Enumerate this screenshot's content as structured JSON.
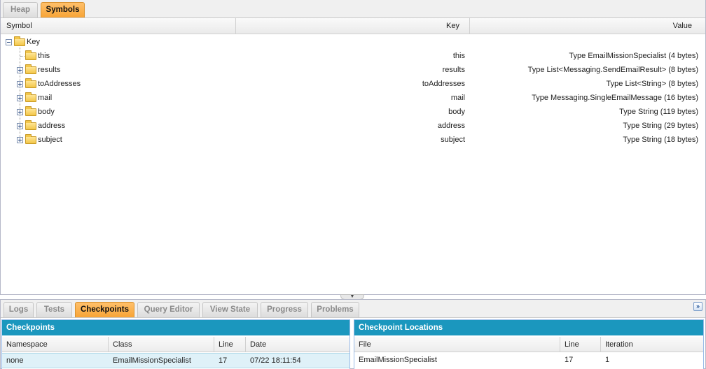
{
  "top_tabs": [
    {
      "label": "Heap",
      "active": false
    },
    {
      "label": "Symbols",
      "active": true
    }
  ],
  "symbols_table": {
    "columns": {
      "symbol": "Symbol",
      "key": "Key",
      "value": "Value"
    },
    "root": {
      "name": "Key",
      "expanded": true
    },
    "rows": [
      {
        "name": "this",
        "key": "this",
        "value": "Type EmailMissionSpecialist (4 bytes)",
        "expandable": false
      },
      {
        "name": "results",
        "key": "results",
        "value": "Type List<Messaging.SendEmailResult> (8 bytes)",
        "expandable": true
      },
      {
        "name": "toAddresses",
        "key": "toAddresses",
        "value": "Type List<String> (8 bytes)",
        "expandable": true
      },
      {
        "name": "mail",
        "key": "mail",
        "value": "Type Messaging.SingleEmailMessage (16 bytes)",
        "expandable": true
      },
      {
        "name": "body",
        "key": "body",
        "value": "Type String (119 bytes)",
        "expandable": true
      },
      {
        "name": "address",
        "key": "address",
        "value": "Type String (29 bytes)",
        "expandable": true
      },
      {
        "name": "subject",
        "key": "subject",
        "value": "Type String (18 bytes)",
        "expandable": true
      }
    ]
  },
  "bottom_tabs": [
    {
      "label": "Logs",
      "active": false
    },
    {
      "label": "Tests",
      "active": false
    },
    {
      "label": "Checkpoints",
      "active": true
    },
    {
      "label": "Query Editor",
      "active": false
    },
    {
      "label": "View State",
      "active": false
    },
    {
      "label": "Progress",
      "active": false
    },
    {
      "label": "Problems",
      "active": false
    }
  ],
  "checkpoints": {
    "title": "Checkpoints",
    "columns": {
      "namespace": "Namespace",
      "class": "Class",
      "line": "Line",
      "date": "Date"
    },
    "rows": [
      {
        "namespace": "none",
        "class": "EmailMissionSpecialist",
        "line": "17",
        "date": "07/22 18:11:54"
      }
    ]
  },
  "checkpoint_locations": {
    "title": "Checkpoint Locations",
    "columns": {
      "file": "File",
      "line": "Line",
      "iteration": "Iteration"
    },
    "rows": [
      {
        "file": "EmailMissionSpecialist",
        "line": "17",
        "iteration": "1"
      }
    ]
  },
  "colors": {
    "active_tab": "#f7a436",
    "panel_header": "#1b97be",
    "selected_row": "#dff1f8"
  },
  "icons": {
    "folder": "folder-icon",
    "expand": "expand-plus-icon",
    "collapse": "collapse-minus-icon",
    "panel_collapse": "double-chevron-down-icon",
    "splitter": "splitter-arrow-icon"
  }
}
